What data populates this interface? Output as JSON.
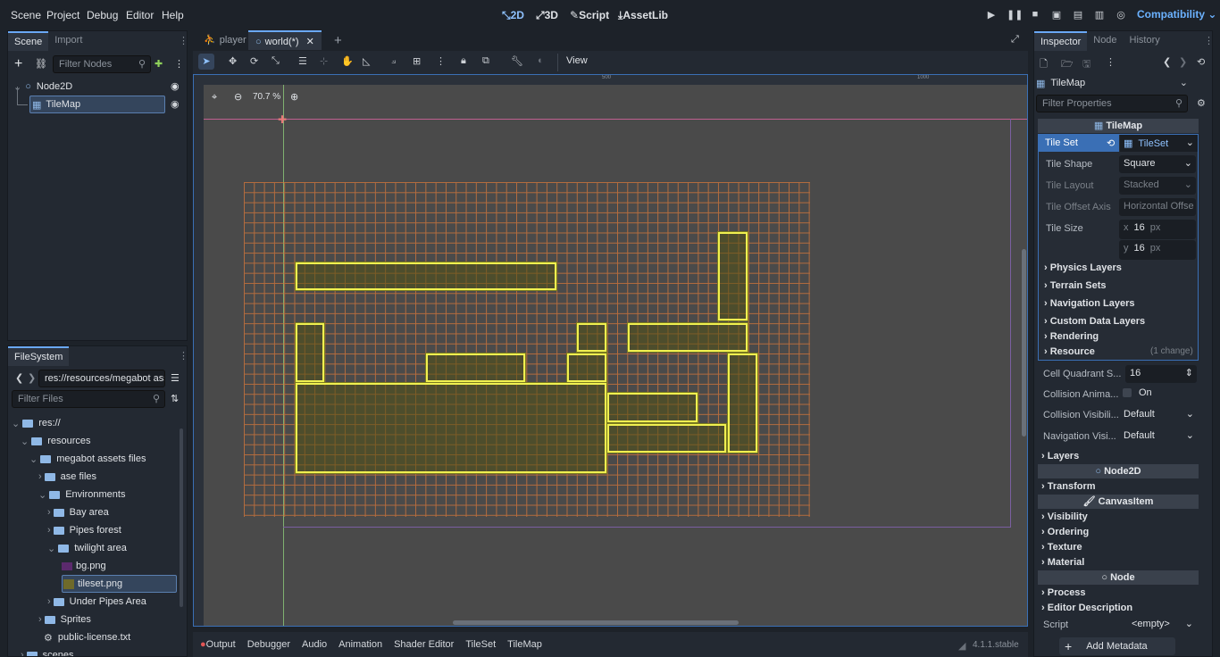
{
  "menu": {
    "items": [
      "Scene",
      "Project",
      "Debug",
      "Editor",
      "Help"
    ]
  },
  "modes": {
    "m2d": "2D",
    "m3d": "3D",
    "script": "Script",
    "assetlib": "AssetLib"
  },
  "renderer": "Compatibility",
  "scene_dock": {
    "tabs": [
      "Scene",
      "Import"
    ],
    "filter_placeholder": "Filter Nodes",
    "nodes": [
      "Node2D",
      "TileMap"
    ]
  },
  "filesystem": {
    "tab": "FileSystem",
    "path": "res://resources/megabot ass",
    "filter_placeholder": "Filter Files",
    "items": [
      "res://",
      "resources",
      "megabot assets files",
      "ase files",
      "Environments",
      "Bay area",
      "Pipes forest",
      "twilight area",
      "bg.png",
      "tileset.png",
      "Under Pipes Area",
      "Sprites",
      "public-license.txt",
      "scenes"
    ]
  },
  "editor_tabs": [
    "player",
    "world(*)"
  ],
  "toolbar": {
    "view": "View",
    "zoom": "70.7 %"
  },
  "ruler": {
    "t500": "500",
    "t1000": "1000"
  },
  "bottom_tabs": [
    "Output",
    "Debugger",
    "Audio",
    "Animation",
    "Shader Editor",
    "TileSet",
    "TileMap"
  ],
  "version": "4.1.1.stable",
  "inspector": {
    "tabs": [
      "Inspector",
      "Node",
      "History"
    ],
    "object": "TileMap",
    "filter_placeholder": "Filter Properties",
    "header": "TileMap",
    "tile_set_label": "Tile Set",
    "tile_set_value": "TileSet",
    "tile_shape_label": "Tile Shape",
    "tile_shape_value": "Square",
    "tile_layout_label": "Tile Layout",
    "tile_layout_value": "Stacked",
    "tile_offset_label": "Tile Offset Axis",
    "tile_offset_value": "Horizontal Offse",
    "tile_size_label": "Tile Size",
    "tile_size_x": "16",
    "tile_size_y": "16",
    "unit": "px",
    "x": "x",
    "y": "y",
    "groups": [
      "Physics Layers",
      "Terrain Sets",
      "Navigation Layers",
      "Custom Data Layers",
      "Rendering",
      "Resource"
    ],
    "resource_change": "(1 change)",
    "cell_quadrant_label": "Cell Quadrant S...",
    "cell_quadrant_value": "16",
    "collision_anim_label": "Collision Anima...",
    "collision_anim_value": "On",
    "collision_vis_label": "Collision Visibili...",
    "collision_vis_value": "Default",
    "nav_vis_label": "Navigation Visi...",
    "nav_vis_value": "Default",
    "layers": "Layers",
    "node2d_header": "Node2D",
    "transform": "Transform",
    "canvasitem_header": "CanvasItem",
    "canvas_groups": [
      "Visibility",
      "Ordering",
      "Texture",
      "Material"
    ],
    "node_header": "Node",
    "node_groups": [
      "Process",
      "Editor Description"
    ],
    "script_label": "Script",
    "script_value": "<empty>",
    "add_metadata": "Add Metadata"
  }
}
